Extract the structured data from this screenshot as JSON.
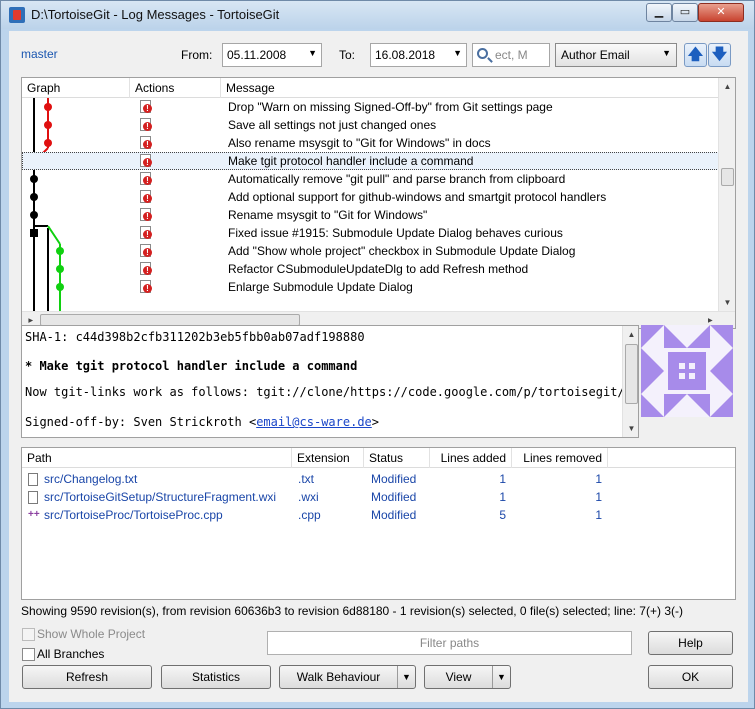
{
  "window": {
    "title": "D:\\TortoiseGit - Log Messages - TortoiseGit",
    "min_glyph": "▁",
    "max_glyph": "▭",
    "close_glyph": "✕"
  },
  "toolbar": {
    "branch": "master",
    "from_label": "From:",
    "from_date": "05.11.2008",
    "to_label": "To:",
    "to_date": "16.08.2018",
    "search_value": "ect, M",
    "search_by": "Author Email",
    "up_glyph": "🡅",
    "down_glyph": "🡇",
    "dropdown_glyph": "▼"
  },
  "log": {
    "columns": [
      "Graph",
      "Actions",
      "Message"
    ],
    "rows": [
      {
        "message": "Drop \"Warn on missing Signed-Off-by\" from Git settings page",
        "selected": false
      },
      {
        "message": "Save all settings not just changed ones",
        "selected": false
      },
      {
        "message": "Also rename msysgit to \"Git for Windows\" in docs",
        "selected": false
      },
      {
        "message": "Make tgit protocol handler include a command",
        "selected": true
      },
      {
        "message": "Automatically remove \"git pull\" and parse branch from clipboard",
        "selected": false
      },
      {
        "message": "Add optional support for github-windows and smartgit protocol handlers",
        "selected": false
      },
      {
        "message": "Rename msysgit to \"Git for Windows\"",
        "selected": false
      },
      {
        "message": "Fixed issue #1915: Submodule Update Dialog behaves curious",
        "selected": false
      },
      {
        "message": "Add \"Show whole project\" checkbox in Submodule Update Dialog",
        "selected": false
      },
      {
        "message": "Refactor CSubmoduleUpdateDlg to add Refresh method",
        "selected": false
      },
      {
        "message": "Enlarge Submodule Update Dialog",
        "selected": false
      }
    ],
    "graph_colors": {
      "main": "#000000",
      "red": "#e01010",
      "green": "#10d010"
    }
  },
  "detail": {
    "sha_line": "SHA-1: c44d398b2cfb311202b3eb5fbb0ab07adf198880",
    "subject": "* Make tgit protocol handler include a command",
    "body": "Now tgit-links work as follows: tgit://clone/https://code.google.com/p/tortoisegit/",
    "signed_prefix": "Signed-off-by: Sven Strickroth <",
    "signed_email": "email@cs-ware.de",
    "signed_suffix": ">",
    "avatar_color": "#a78bea"
  },
  "files": {
    "columns": [
      "Path",
      "Extension",
      "Status",
      "Lines added",
      "Lines removed"
    ],
    "rows": [
      {
        "path": "src/Changelog.txt",
        "ext": ".txt",
        "status": "Modified",
        "added": "1",
        "removed": "1"
      },
      {
        "path": "src/TortoiseGitSetup/StructureFragment.wxi",
        "ext": ".wxi",
        "status": "Modified",
        "added": "1",
        "removed": "1"
      },
      {
        "path": "src/TortoiseProc/TortoiseProc.cpp",
        "ext": ".cpp",
        "status": "Modified",
        "added": "5",
        "removed": "1"
      }
    ],
    "changed_glyph": "++"
  },
  "status_bar": "Showing 9590 revision(s), from revision 60636b3 to revision 6d88180 - 1 revision(s) selected, 0 file(s) selected; line: 7(+) 3(-)",
  "options": {
    "show_whole_project": "Show Whole Project",
    "all_branches": "All Branches",
    "filter_placeholder": "Filter paths"
  },
  "buttons": {
    "help": "Help",
    "refresh": "Refresh",
    "statistics": "Statistics",
    "walk_behaviour": "Walk Behaviour",
    "view": "View",
    "ok": "OK"
  }
}
